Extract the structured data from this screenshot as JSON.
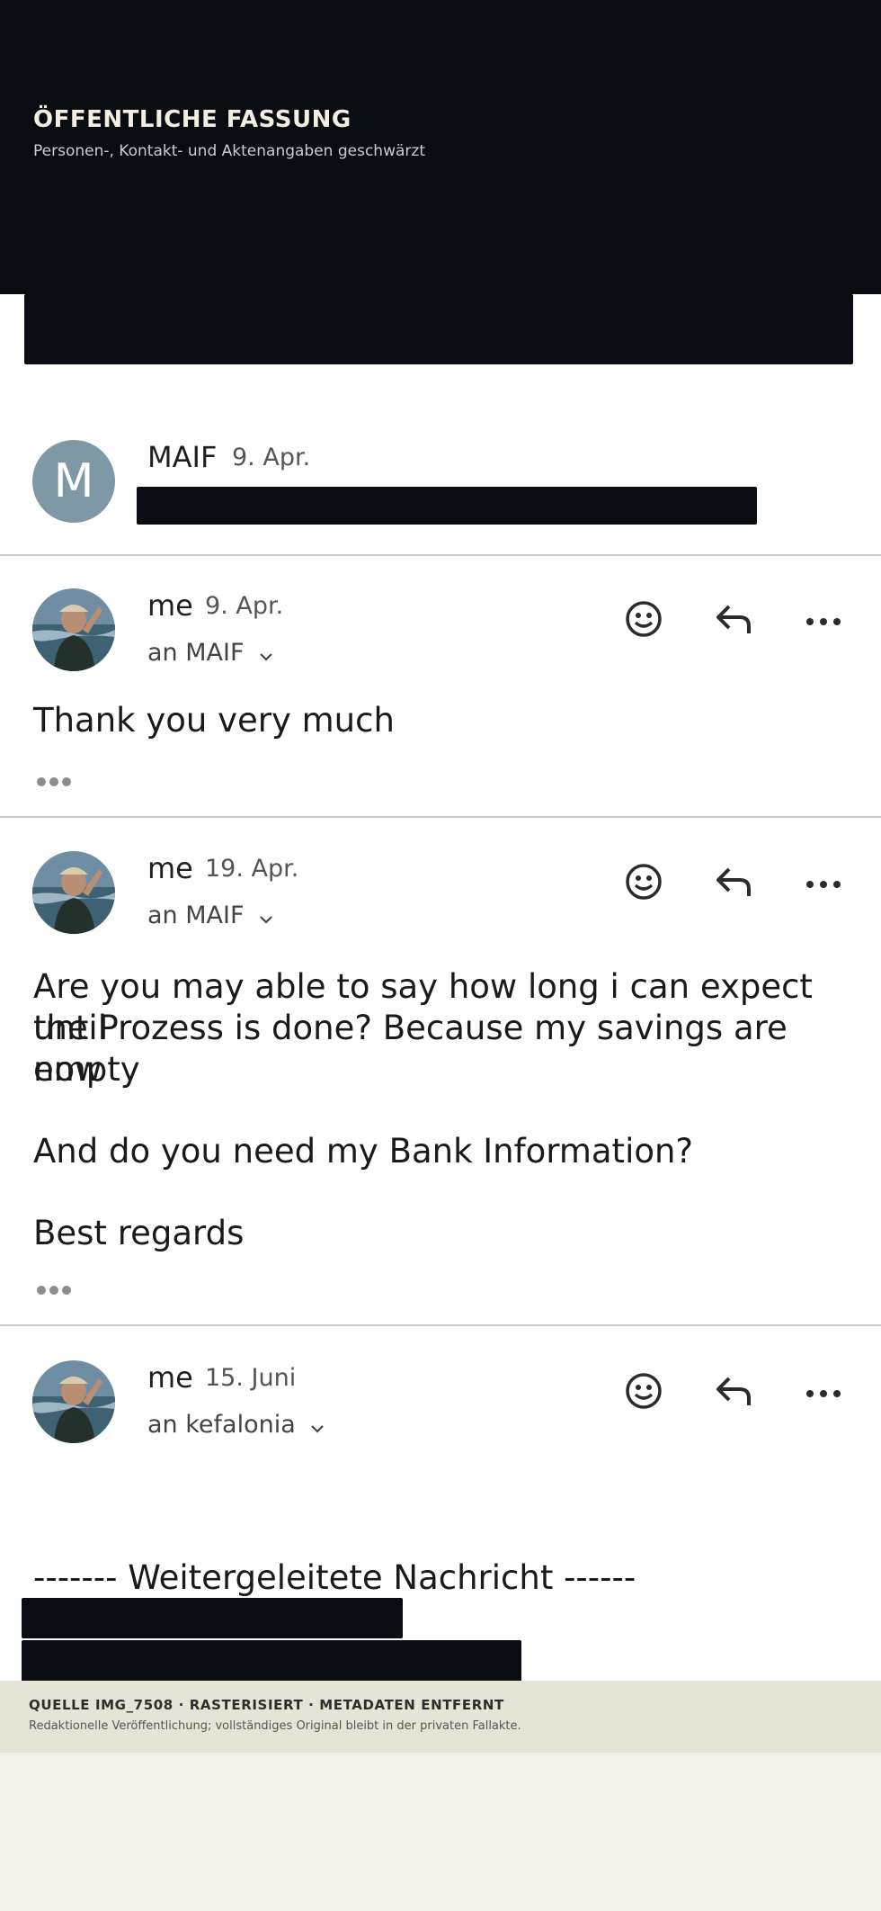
{
  "header": {
    "title": "ÖFFENTLICHE FASSUNG",
    "subtitle": "Personen-, Kontakt- und Aktenangaben geschwärzt"
  },
  "messages": [
    {
      "sender": "MAIF",
      "avatar_letter": "M",
      "date": "9. Apr."
    },
    {
      "sender": "me",
      "date": "9. Apr.",
      "recipient": "an MAIF",
      "body": "Thank you very much"
    },
    {
      "sender": "me",
      "date": "19. Apr.",
      "recipient": "an MAIF",
      "body_lines": [
        "Are you may able to say how long i can expect until",
        "the Prozess is done? Because my savings are empty",
        "now",
        "And do you need my Bank Information?",
        "Best regards"
      ]
    },
    {
      "sender": "me",
      "date": "15. Juni",
      "recipient": "an kefalonia",
      "body": "------- Weitergeleitete Nachricht ------"
    }
  ],
  "icons": {
    "react": "smiley-icon",
    "reply": "reply-icon",
    "more": "more-icon",
    "expand": "ellipsis-icon"
  },
  "footer": {
    "title": "QUELLE IMG_7508 · RASTERISIERT · METADATEN ENTFERNT",
    "subtitle": "Redaktionelle Veröffentlichung; vollständiges Original bleibt in der privaten Fallakte."
  },
  "colors": {
    "redaction": "#090c11",
    "avatar_bg": "#7f98a6",
    "footer_bg": "#e6e4d6",
    "page_bg": "#f2f1ea"
  }
}
